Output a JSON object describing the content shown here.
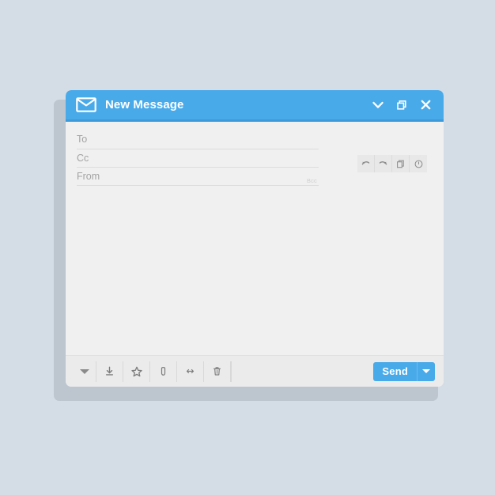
{
  "page": {
    "background_color": "#d4dce6"
  },
  "window": {
    "title": "New Message",
    "title_icon": "envelope-icon",
    "accent_color": "#49aaea",
    "body_color": "#f0f0f0",
    "controls": [
      {
        "name": "minimize",
        "icon": "chevron-down-icon"
      },
      {
        "name": "restore",
        "icon": "restore-window-icon"
      },
      {
        "name": "close",
        "icon": "close-icon"
      }
    ]
  },
  "fields": [
    {
      "name": "to",
      "label": "To",
      "value": "",
      "placeholder": "To"
    },
    {
      "name": "cc",
      "label": "Cc",
      "value": "",
      "placeholder": "Cc"
    },
    {
      "name": "from",
      "label": "From",
      "value": "",
      "placeholder": "From"
    }
  ],
  "bcc_toggle": {
    "label": "Bcc"
  },
  "message_body": {
    "value": "",
    "placeholder": ""
  },
  "right_toolbar": {
    "buttons": [
      {
        "name": "undo",
        "icon": "undo-arrow-icon"
      },
      {
        "name": "redo",
        "icon": "redo-arrow-icon"
      },
      {
        "name": "copy",
        "icon": "copy-icon"
      },
      {
        "name": "info",
        "icon": "info-circle-icon"
      }
    ]
  },
  "footer_toolbar": {
    "buttons": [
      {
        "name": "more-options",
        "icon": "triangle-down-icon"
      },
      {
        "name": "save-draft",
        "icon": "download-icon"
      },
      {
        "name": "star",
        "icon": "star-icon"
      },
      {
        "name": "attach",
        "icon": "paperclip-icon"
      },
      {
        "name": "insert-link",
        "icon": "link-icon"
      },
      {
        "name": "discard",
        "icon": "trash-icon"
      }
    ]
  },
  "send": {
    "label": "Send",
    "dropdown_icon": "triangle-down-icon",
    "color": "#49aaea"
  }
}
